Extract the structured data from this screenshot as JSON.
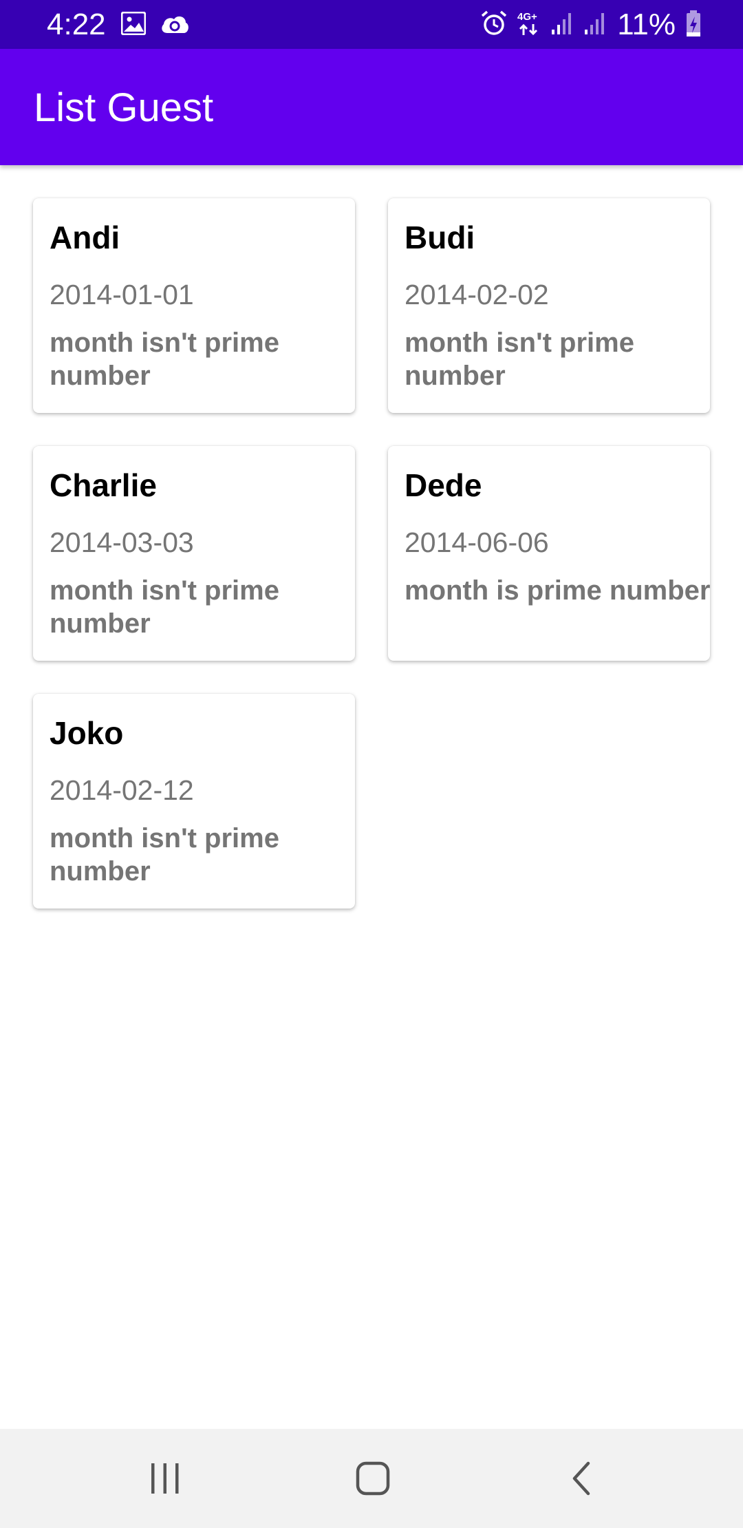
{
  "status_bar": {
    "time": "4:22",
    "battery": "11%",
    "icons": [
      "image-icon",
      "cloud-sync-icon",
      "alarm-icon",
      "network-4g-icon",
      "signal-icon",
      "signal-icon",
      "battery-charging-icon"
    ]
  },
  "app_bar": {
    "title": "List Guest",
    "color": "#6200ee"
  },
  "guests": [
    {
      "name": "Andi",
      "date": "2014-01-01",
      "status": "month isn't prime number"
    },
    {
      "name": "Budi",
      "date": "2014-02-02",
      "status": "month isn't prime number"
    },
    {
      "name": "Charlie",
      "date": "2014-03-03",
      "status": "month isn't prime number"
    },
    {
      "name": "Dede",
      "date": "2014-06-06",
      "status": "month is prime number"
    },
    {
      "name": "Joko",
      "date": "2014-02-12",
      "status": "month isn't prime number"
    }
  ],
  "nav_bar": {
    "buttons": [
      "recent-apps-icon",
      "home-icon",
      "back-icon"
    ]
  }
}
